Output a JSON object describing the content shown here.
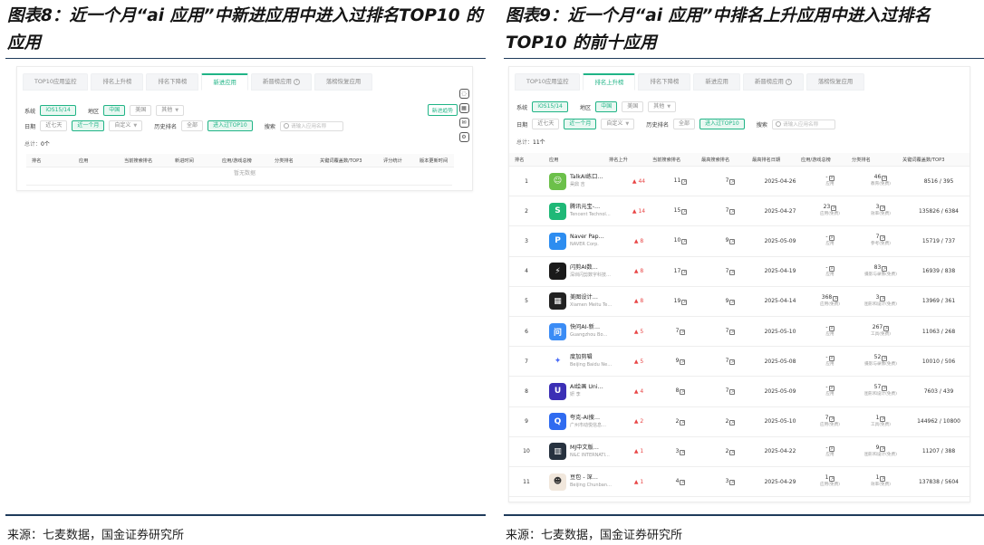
{
  "left": {
    "figure_title": "图表8：近一个月“ai 应用”中新进应用中进入过排名TOP10 的应用",
    "source": "来源：七麦数据，国金证券研究所",
    "tabs": [
      "TOP10应用监控",
      "排名上升榜",
      "排名下降榜",
      "新进应用",
      "新晋榜应用",
      "落榜恢复应用"
    ],
    "active_tab": 3,
    "filters": {
      "system_label": "系统",
      "system_value": "iOS15/14",
      "region_label": "地区",
      "region_options": [
        "中国",
        "美国",
        "其他"
      ],
      "date_label": "日期",
      "date_options": [
        "近七天",
        "近一个月",
        "自定义"
      ],
      "history_label": "历史排名",
      "history_options": [
        "全部",
        "进入过TOP10"
      ],
      "search_label": "搜索",
      "search_placeholder": "请输入应用名称"
    },
    "total_label": "总计：",
    "total_value": "0个",
    "columns": [
      "排名",
      "应用",
      "当前搜索排名",
      "新进时间",
      "应用/游戏总榜",
      "分类排名",
      "关键词覆盖数/TOP3",
      "评分统计",
      "版本更新时间"
    ],
    "empty_text": "暂无数据",
    "side_button": "新进趋势",
    "side_icons": [
      "chat-icon",
      "qrcode-icon",
      "mail-icon",
      "settings-icon"
    ]
  },
  "right": {
    "figure_title": "图表9：近一个月“ai 应用”中排名上升应用中进入过排名 TOP10 的前十应用",
    "source": "来源：七麦数据，国金证券研究所",
    "tabs": [
      "TOP10应用监控",
      "排名上升榜",
      "排名下降榜",
      "新进应用",
      "新晋榜应用",
      "落榜恢复应用"
    ],
    "active_tab": 1,
    "filters": {
      "system_label": "系统",
      "system_value": "iOS15/14",
      "region_label": "地区",
      "region_options": [
        "中国",
        "美国",
        "其他"
      ],
      "date_label": "日期",
      "date_options": [
        "近七天",
        "近一个月",
        "自定义"
      ],
      "history_label": "历史排名",
      "history_options": [
        "全部",
        "进入过TOP10"
      ],
      "search_label": "搜索",
      "search_placeholder": "请输入应用名称"
    },
    "total_label": "总计：",
    "total_value": "11个",
    "columns": [
      "排名",
      "应用",
      "排名上升",
      "当前搜索排名",
      "最高搜索排名",
      "最高排名日期",
      "应用/游戏总榜",
      "分类排名",
      "关键词覆盖数/TOP3"
    ],
    "rows": [
      {
        "rank": "1",
        "name": "TalkAI练口…",
        "dev": "昊鼎 吉",
        "rise": "44",
        "cur": "11",
        "best": "7",
        "date": "2025-04-26",
        "overall": "-",
        "overall_sub": "应用",
        "cat": "46",
        "cat_sub": "教育(免费)",
        "kw": "8516 / 395",
        "color": "#6cc04a",
        "glyph": "☺"
      },
      {
        "rank": "2",
        "name": "腾讯元宝-…",
        "dev": "Tencent Technol…",
        "rise": "14",
        "cur": "15",
        "best": "7",
        "date": "2025-04-27",
        "overall": "23",
        "overall_sub": "应用(免费)",
        "cat": "3",
        "cat_sub": "效率(免费)",
        "kw": "135826 / 6384",
        "color": "#1fb877",
        "glyph": "S"
      },
      {
        "rank": "3",
        "name": "Naver Pap…",
        "dev": "NAVER Corp.",
        "rise": "8",
        "cur": "10",
        "best": "9",
        "date": "2025-05-09",
        "overall": "-",
        "overall_sub": "应用",
        "cat": "7",
        "cat_sub": "参考(免费)",
        "kw": "15719 / 737",
        "color": "#2d8df0",
        "glyph": "P"
      },
      {
        "rank": "4",
        "name": "闪剪AI数…",
        "dev": "深圳闪剪数字科技…",
        "rise": "8",
        "cur": "17",
        "best": "7",
        "date": "2025-04-19",
        "overall": "-",
        "overall_sub": "应用",
        "cat": "83",
        "cat_sub": "摄影与录像(免费)",
        "kw": "16939 / 838",
        "color": "#1a1a1a",
        "glyph": "⚡"
      },
      {
        "rank": "5",
        "name": "美图设计…",
        "dev": "Xiamen Meitu Te…",
        "rise": "8",
        "cur": "19",
        "best": "9",
        "date": "2025-04-14",
        "overall": "368",
        "overall_sub": "应用(免费)",
        "cat": "3",
        "cat_sub": "图形和设计(免费)",
        "kw": "13969 / 361",
        "color": "#222222",
        "glyph": "▦"
      },
      {
        "rank": "6",
        "name": "快问AI-新…",
        "dev": "Guangzhou Bo…",
        "rise": "5",
        "cur": "7",
        "best": "7",
        "date": "2025-05-10",
        "overall": "-",
        "overall_sub": "应用",
        "cat": "267",
        "cat_sub": "工具(免费)",
        "kw": "11063 / 268",
        "color": "#3b8cf5",
        "glyph": "问"
      },
      {
        "rank": "7",
        "name": "度加剪辑",
        "dev": "Beijing Baidu Ne…",
        "rise": "5",
        "cur": "9",
        "best": "7",
        "date": "2025-05-08",
        "overall": "-",
        "overall_sub": "应用",
        "cat": "52",
        "cat_sub": "摄影与录像(免费)",
        "kw": "10010 / 506",
        "color": "#ffffff",
        "glyph": "✦"
      },
      {
        "rank": "8",
        "name": "AI绘画 Uni…",
        "dev": "妍 李",
        "rise": "4",
        "cur": "8",
        "best": "7",
        "date": "2025-05-09",
        "overall": "-",
        "overall_sub": "应用",
        "cat": "57",
        "cat_sub": "图形和设计(免费)",
        "kw": "7603 / 439",
        "color": "#3b2fb5",
        "glyph": "U"
      },
      {
        "rank": "9",
        "name": "夸克-AI搜…",
        "dev": "广州市动悦信息…",
        "rise": "2",
        "cur": "2",
        "best": "2",
        "date": "2025-05-10",
        "overall": "7",
        "overall_sub": "应用(免费)",
        "cat": "1",
        "cat_sub": "工具(免费)",
        "kw": "144962 / 10800",
        "color": "#2f6bf0",
        "glyph": "Q"
      },
      {
        "rank": "10",
        "name": "MJ中文版…",
        "dev": "N&C INTERNATI…",
        "rise": "1",
        "cur": "3",
        "best": "2",
        "date": "2025-04-22",
        "overall": "-",
        "overall_sub": "应用",
        "cat": "9",
        "cat_sub": "图形和设计(免费)",
        "kw": "11207 / 388",
        "color": "#27323f",
        "glyph": "▥"
      },
      {
        "rank": "11",
        "name": "豆包 - 深…",
        "dev": "Beijing Chunban…",
        "rise": "1",
        "cur": "4",
        "best": "3",
        "date": "2025-04-29",
        "overall": "1",
        "overall_sub": "应用(免费)",
        "cat": "1",
        "cat_sub": "效率(免费)",
        "kw": "137838 / 5604",
        "color": "#f1e7dc",
        "glyph": "☻"
      }
    ]
  }
}
